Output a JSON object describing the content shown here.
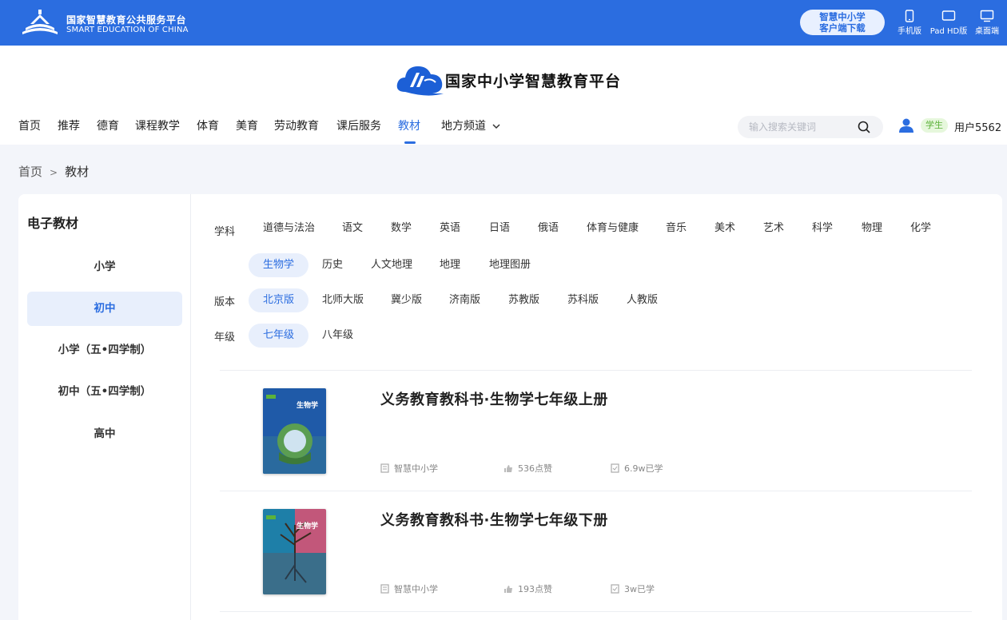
{
  "topbar": {
    "title": "国家智慧教育公共服务平台",
    "subtitle": "SMART EDUCATION OF CHINA",
    "download_line1": "智慧中小学",
    "download_line2": "客户端下载",
    "devices": [
      "手机版",
      "Pad HD版",
      "桌面端"
    ]
  },
  "header": {
    "brand_name": "国家中小学智慧教育平台",
    "nav": [
      "首页",
      "推荐",
      "德育",
      "课程教学",
      "体育",
      "美育",
      "劳动教育",
      "课后服务",
      "教材",
      "地方频道"
    ],
    "active_nav": "教材",
    "search_placeholder": "输入搜索关键词",
    "role_badge": "学生",
    "user_name": "用户5562"
  },
  "breadcrumb": [
    "首页",
    "教材"
  ],
  "sidebar": {
    "title": "电子教材",
    "items": [
      "小学",
      "初中",
      "小学（五•四学制）",
      "初中（五•四学制）",
      "高中"
    ],
    "active": "初中"
  },
  "filters": {
    "subject_label": "学科",
    "subjects": [
      "道德与法治",
      "语文",
      "数学",
      "英语",
      "日语",
      "俄语",
      "体育与健康",
      "音乐",
      "美术",
      "艺术",
      "科学",
      "物理",
      "化学",
      "生物学",
      "历史",
      "人文地理",
      "地理",
      "地理图册"
    ],
    "subject_active": "生物学",
    "edition_label": "版本",
    "editions": [
      "北京版",
      "北师大版",
      "冀少版",
      "济南版",
      "苏教版",
      "苏科版",
      "人教版"
    ],
    "edition_active": "北京版",
    "grade_label": "年级",
    "grades": [
      "七年级",
      "八年级"
    ],
    "grade_active": "七年级"
  },
  "books": [
    {
      "title": "义务教育教科书·生物学七年级上册",
      "source": "智慧中小学",
      "likes": "536点赞",
      "learned": "6.9w已学",
      "cover_text": "生物学"
    },
    {
      "title": "义务教育教科书·生物学七年级下册",
      "source": "智慧中小学",
      "likes": "193点赞",
      "learned": "3w已学",
      "cover_text": "生物学"
    }
  ],
  "colors": {
    "primary": "#2b6de0",
    "active_bg": "#e8effc",
    "badge_green": "#5cb23a"
  }
}
